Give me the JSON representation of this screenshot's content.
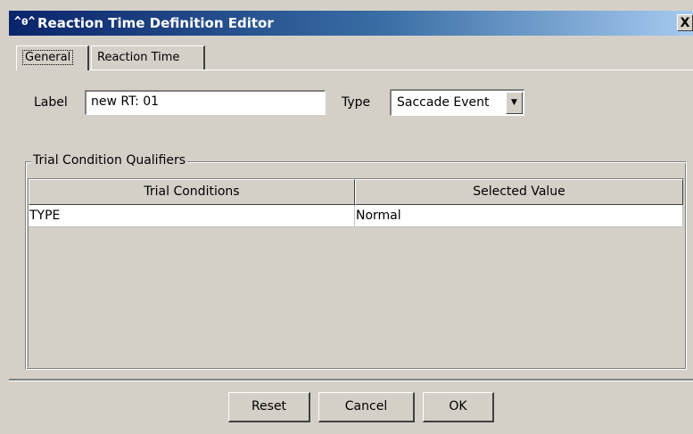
{
  "window": {
    "icon": "^ɵ^",
    "title": "Reaction Time Definition Editor",
    "close_label": "X"
  },
  "tabs": [
    {
      "label": "General",
      "active": true
    },
    {
      "label": "Reaction Time",
      "active": false
    }
  ],
  "form": {
    "label_caption": "Label",
    "label_value": "new RT: 01",
    "type_caption": "Type",
    "type_value": "Saccade Event"
  },
  "qualifiers": {
    "title": "Trial Condition Qualifiers",
    "columns": [
      "Trial Conditions",
      "Selected Value"
    ],
    "rows": [
      [
        "TYPE",
        "Normal"
      ]
    ]
  },
  "buttons": {
    "reset": "Reset",
    "cancel": "Cancel",
    "ok": "OK"
  },
  "icons": {
    "app": "app-logo-icon",
    "close": "close-icon",
    "dropdown": "chevron-down-icon"
  },
  "colors": {
    "titlebar_start": "#0a246a",
    "titlebar_end": "#a6caf0",
    "face": "#d4d0c8"
  }
}
